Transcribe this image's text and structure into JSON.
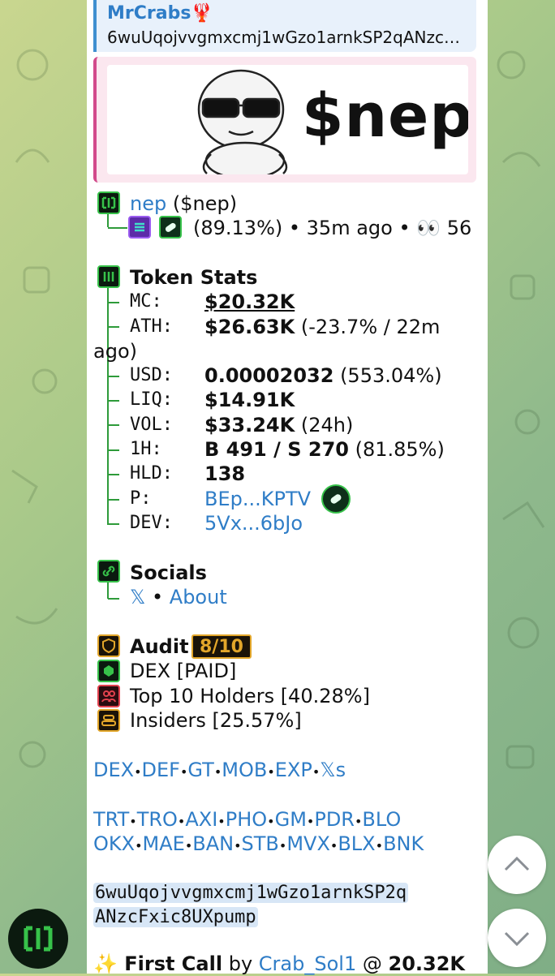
{
  "reply": {
    "author": "MrCrabs🦞",
    "text": "6wuUqojvvgmxcmj1wGzo1arnkSP2qANzcFxic8UXpump"
  },
  "preview": {
    "ticker_art": "$nep"
  },
  "token": {
    "name": "nep",
    "symbol": "($nep)",
    "stats_line": "(89.13%) • 35m ago • 👀 56"
  },
  "stats": {
    "title": "Token Stats",
    "mc_label": "MC:",
    "mc": "$20.32K",
    "ath_label": "ATH:",
    "ath": "$26.63K",
    "ath_extra": "(-23.7% / 22m",
    "ath_wrap": "ago)",
    "usd_label": "USD:",
    "usd": "0.00002032",
    "usd_extra": "(553.04%)",
    "liq_label": "LIQ:",
    "liq": "$14.91K",
    "vol_label": "VOL:",
    "vol": "$33.24K",
    "vol_extra": "(24h)",
    "h1_label": "1H:",
    "h1": "B 491 / S 270",
    "h1_extra": "(81.85%)",
    "hld_label": "HLD:",
    "hld": "138",
    "p_label": "P:",
    "p": "BEp...KPTV",
    "dev_label": "DEV:",
    "dev": "5Vx...6bJo"
  },
  "socials": {
    "title": "Socials",
    "x": "𝕏",
    "sep": "•",
    "about": "About"
  },
  "audit": {
    "title": "Audit",
    "score": "8/10",
    "dex": "DEX [PAID]",
    "top10": "Top 10 Holders [40.28%]",
    "insiders": "Insiders [25.57%]"
  },
  "links_row1": [
    "DEX",
    "DEF",
    "GT",
    "MOB",
    "EXP",
    "𝕏s"
  ],
  "links_row2": [
    "TRT",
    "TRO",
    "AXI",
    "PHO",
    "GM",
    "PDR",
    "BLO"
  ],
  "links_row3": [
    "OKX",
    "MAE",
    "BAN",
    "STB",
    "MVX",
    "BLX",
    "BNK"
  ],
  "ca": {
    "line1": "6wuUqojvvgmxcmj1wGzo1arnkSP2q",
    "line2": "ANzcFxic8UXpump"
  },
  "first_call": {
    "prefix": "✨ First Call",
    "by": "by",
    "user": "Crab_Sol1",
    "at": "@",
    "value": "20.32K"
  },
  "colors": {
    "green": "#37c24a",
    "gold": "#e2a62a",
    "link": "#2f7dc7"
  }
}
